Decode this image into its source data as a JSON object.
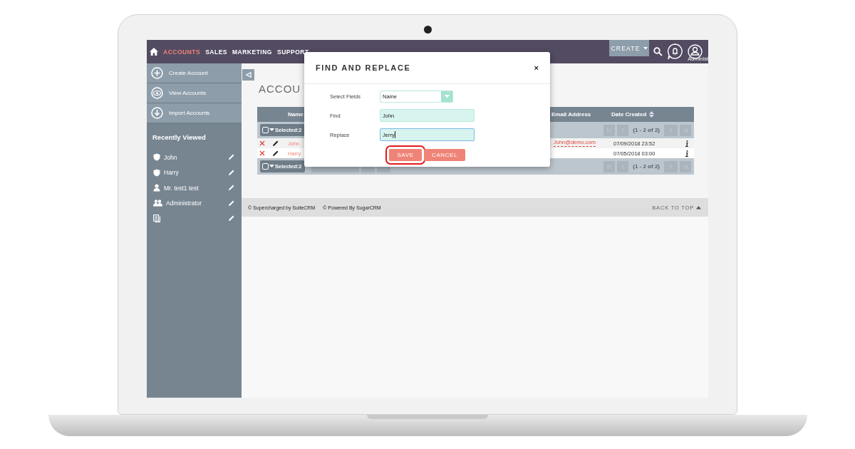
{
  "nav": {
    "items": [
      {
        "label": "ACCOUNTS",
        "selected": true
      },
      {
        "label": "SALES",
        "selected": false
      },
      {
        "label": "MARKETING",
        "selected": false
      },
      {
        "label": "SUPPORT",
        "selected": false
      }
    ],
    "create_label": "CREATE",
    "user_label": "Administ"
  },
  "sidebar": {
    "actions": [
      {
        "label": "Create Account",
        "kind": "plus"
      },
      {
        "label": "View Accounts",
        "kind": "eye"
      },
      {
        "label": "Import Accounts",
        "kind": "download"
      }
    ],
    "recent_title": "Recently Viewed",
    "recent": [
      {
        "label": "John",
        "kind": "account"
      },
      {
        "label": "Harry",
        "kind": "account"
      },
      {
        "label": "Mr. test1 test",
        "kind": "contact"
      },
      {
        "label": "Administrator",
        "kind": "users"
      },
      {
        "kind": "document"
      }
    ]
  },
  "page_title": "ACCOU",
  "table": {
    "columns": [
      "Name",
      "Email Address",
      "Date Created"
    ],
    "selected_label": "Selected:2",
    "pagination": "(1 - 2 of 2)",
    "rows": [
      {
        "name": "John",
        "email": "John@demo.com",
        "date_created": "07/09/2018 23:52"
      },
      {
        "name": "Harry",
        "date_created": "07/05/2018 03:00"
      }
    ],
    "footer_selected_label": "Selected:2",
    "footer_pagination": "(1 - 2 of 2)"
  },
  "footer": {
    "credits": [
      "© Supercharged by SuiteCRM",
      "© Powered By SugarCRM"
    ],
    "back_to_top": "BACK TO TOP"
  },
  "dialog": {
    "title": "FIND AND REPLACE",
    "close_label": "×",
    "fields": [
      {
        "label": "Select Fields",
        "kind": "select",
        "value": "Name",
        "focused": false
      },
      {
        "label": "Find",
        "kind": "text",
        "value": "John",
        "focused": false
      },
      {
        "label": "Replace",
        "kind": "text",
        "value": "Jerry",
        "focused": true
      }
    ],
    "buttons": [
      {
        "label": "SAVE",
        "highlighted": true
      },
      {
        "label": "CANCEL",
        "highlighted": false
      }
    ]
  }
}
